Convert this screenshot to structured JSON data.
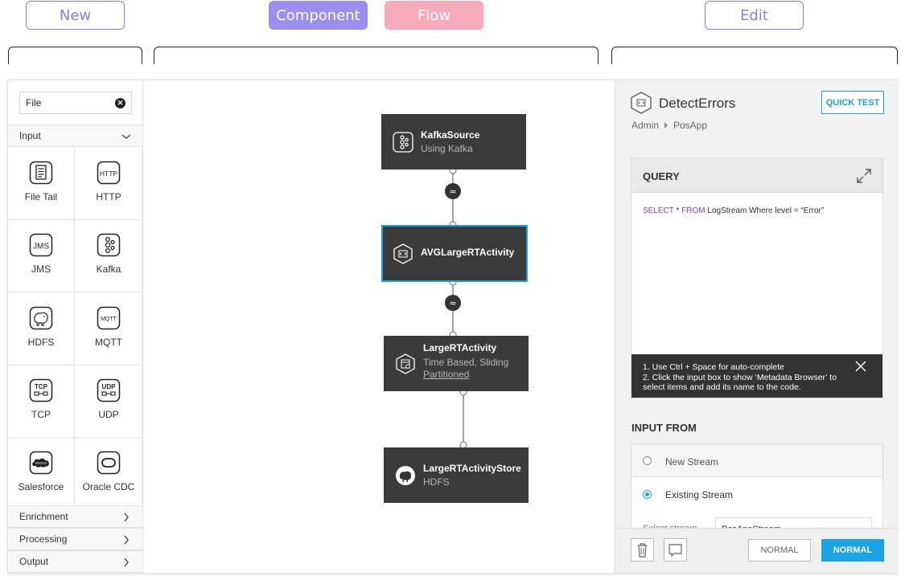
{
  "annotations": {
    "new": "New",
    "component": "Component",
    "flow": "Flow",
    "edit": "Edit"
  },
  "sidebar": {
    "search_value": "File",
    "input_category": "Input",
    "components": [
      {
        "label": "File Tail",
        "icon": "file-list-icon"
      },
      {
        "label": "HTTP",
        "icon": "http-icon",
        "badge": "HTTP"
      },
      {
        "label": "JMS",
        "icon": "jms-icon",
        "badge": "JMS"
      },
      {
        "label": "Kafka",
        "icon": "kafka-icon"
      },
      {
        "label": "HDFS",
        "icon": "hdfs-elephant-icon"
      },
      {
        "label": "MQTT",
        "icon": "mqtt-icon",
        "badge": "MQTT"
      },
      {
        "label": "TCP",
        "icon": "tcp-icon",
        "badge": "TCP"
      },
      {
        "label": "UDP",
        "icon": "udp-icon",
        "badge": "UDP"
      },
      {
        "label": "Salesforce",
        "icon": "salesforce-cloud-icon",
        "badge": "salesforce"
      },
      {
        "label": "Oracle CDC",
        "icon": "oracle-icon"
      }
    ],
    "categories": [
      "Enrichment",
      "Processing",
      "Output"
    ]
  },
  "flow": {
    "nodes": [
      {
        "title": "KafkaSource",
        "subtitle": "Using Kafka",
        "icon": "kafka-icon"
      },
      {
        "title": "AVGLargeRTActivity",
        "icon": "code-hex-icon",
        "selected": true
      },
      {
        "title": "LargeRTActivity",
        "subtitle": "Time Based, Sliding",
        "link": "Partitioned",
        "icon": "window-hex-icon"
      },
      {
        "title": "LargeRTActivityStore",
        "subtitle": "HDFS",
        "icon": "hdfs-elephant-icon"
      }
    ]
  },
  "editor": {
    "title": "DetectErrors",
    "quick_test": "QUICK TEST",
    "breadcrumb": [
      "Admin",
      "PosApp"
    ],
    "query_label": "QUERY",
    "query": {
      "kw1": "SELECT",
      "part1": " * ",
      "kw2": "FROM",
      "part2": " LogStream Where level = “Error”"
    },
    "tips": [
      "1. Use Ctrl + Space for auto-complete",
      "2. Click the input box to show ‘Metadata Browser’ to select items and add its name to the code."
    ],
    "input_from_label": "INPUT FROM",
    "options": [
      "New Stream",
      "Existing Stream"
    ],
    "selected_option": "Existing Stream",
    "select_stream_label": "Select stream",
    "select_stream_value": "PosAppStream",
    "footer_buttons": [
      "NORMAL",
      "NORMAL"
    ],
    "accent_color": "#1aa3e0"
  }
}
